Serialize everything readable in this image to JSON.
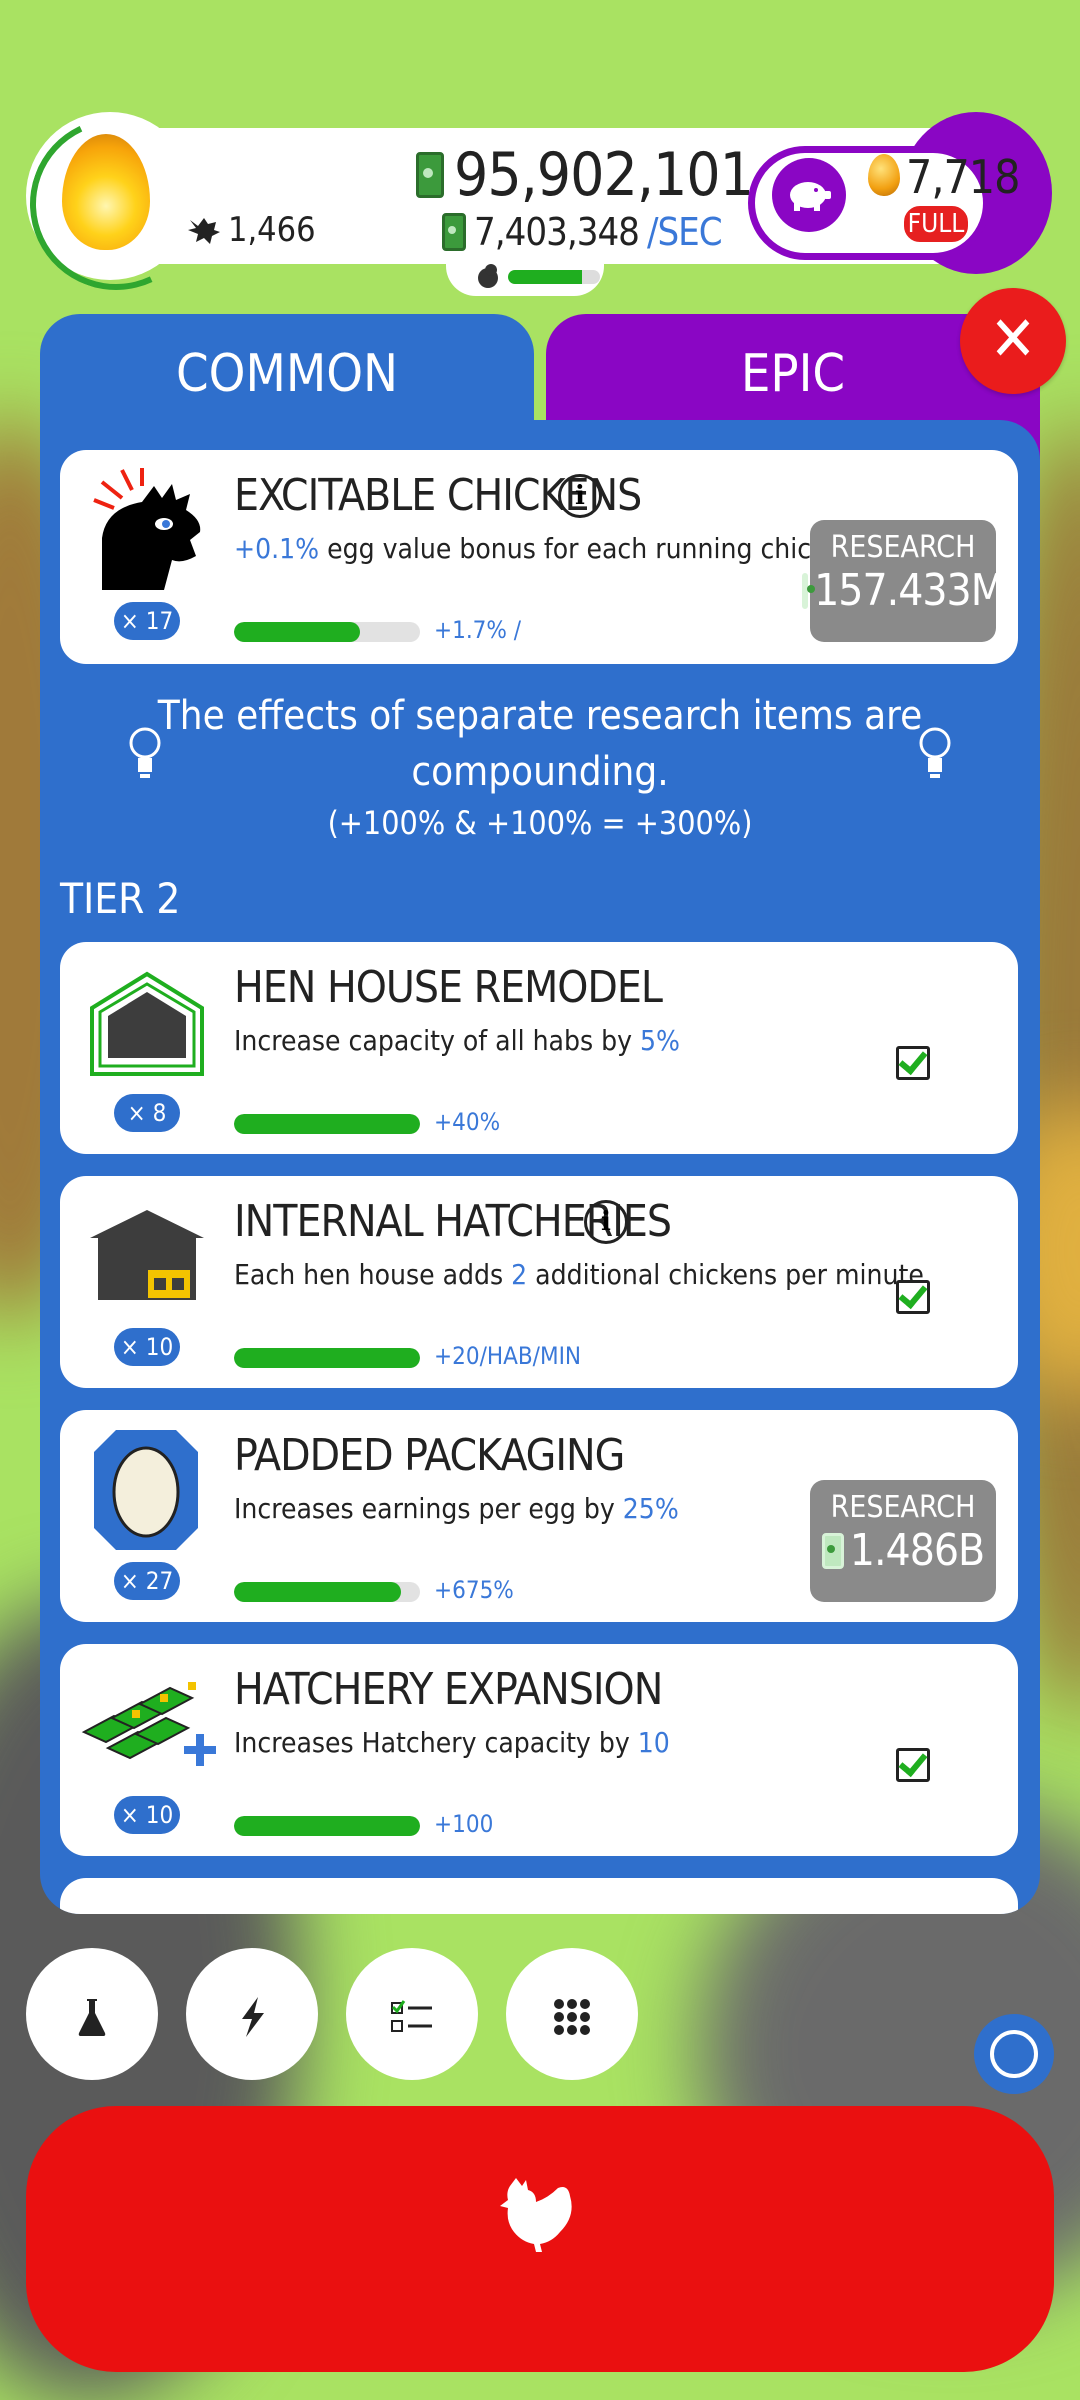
{
  "hud": {
    "chicken_count": "1,466",
    "money": "95,902,101",
    "money_rate": "7,403,348",
    "money_rate_unit": "/SEC",
    "hab_progress_percent": 80,
    "golden_eggs": "7,718",
    "full_label": "FULL"
  },
  "tabs": {
    "common": "COMMON",
    "epic": "EPIC"
  },
  "research": {
    "excitable": {
      "title": "EXCITABLE CHICKENS",
      "desc_hl": "+0.1%",
      "desc_rest": " egg value bonus for each running chicken",
      "level": "× 17",
      "bonus": "+1.7% /",
      "progress_percent": 68,
      "button_label": "RESEARCH",
      "cost": "157.433M"
    },
    "tip": {
      "line1": "The effects of separate research items are",
      "line2": "compounding.",
      "line3": "(+100% & +100% = +300%)"
    },
    "tier_label": "TIER 2",
    "hen_house": {
      "title": "HEN HOUSE REMODEL",
      "desc_pre": "Increase capacity of all habs by ",
      "desc_hl": "5%",
      "level": "× 8",
      "bonus": "+40%",
      "progress_percent": 100
    },
    "hatcheries": {
      "title": "INTERNAL HATCHERIES",
      "desc_pre": "Each hen house adds ",
      "desc_hl": "2",
      "desc_post": " additional chickens per minute",
      "level": "× 10",
      "bonus": "+20/HAB/MIN",
      "progress_percent": 100
    },
    "padded": {
      "title": "PADDED PACKAGING",
      "desc_pre": "Increases earnings per egg by ",
      "desc_hl": "25%",
      "level": "× 27",
      "bonus": "+675%",
      "progress_percent": 90,
      "button_label": "RESEARCH",
      "cost": "1.486B"
    },
    "expansion": {
      "title": "HATCHERY EXPANSION",
      "desc_pre": "Increases Hatchery capacity by ",
      "desc_hl": "10",
      "level": "× 10",
      "bonus": "+100",
      "progress_percent": 100
    }
  },
  "bottom": {
    "icons": [
      "flask-icon",
      "lightning-icon",
      "checklist-icon",
      "grid-icon"
    ]
  },
  "colors": {
    "accent_blue": "#2f6fcc",
    "epic_purple": "#8a06c4",
    "red": "#ea1010",
    "green": "#1fae1f"
  }
}
